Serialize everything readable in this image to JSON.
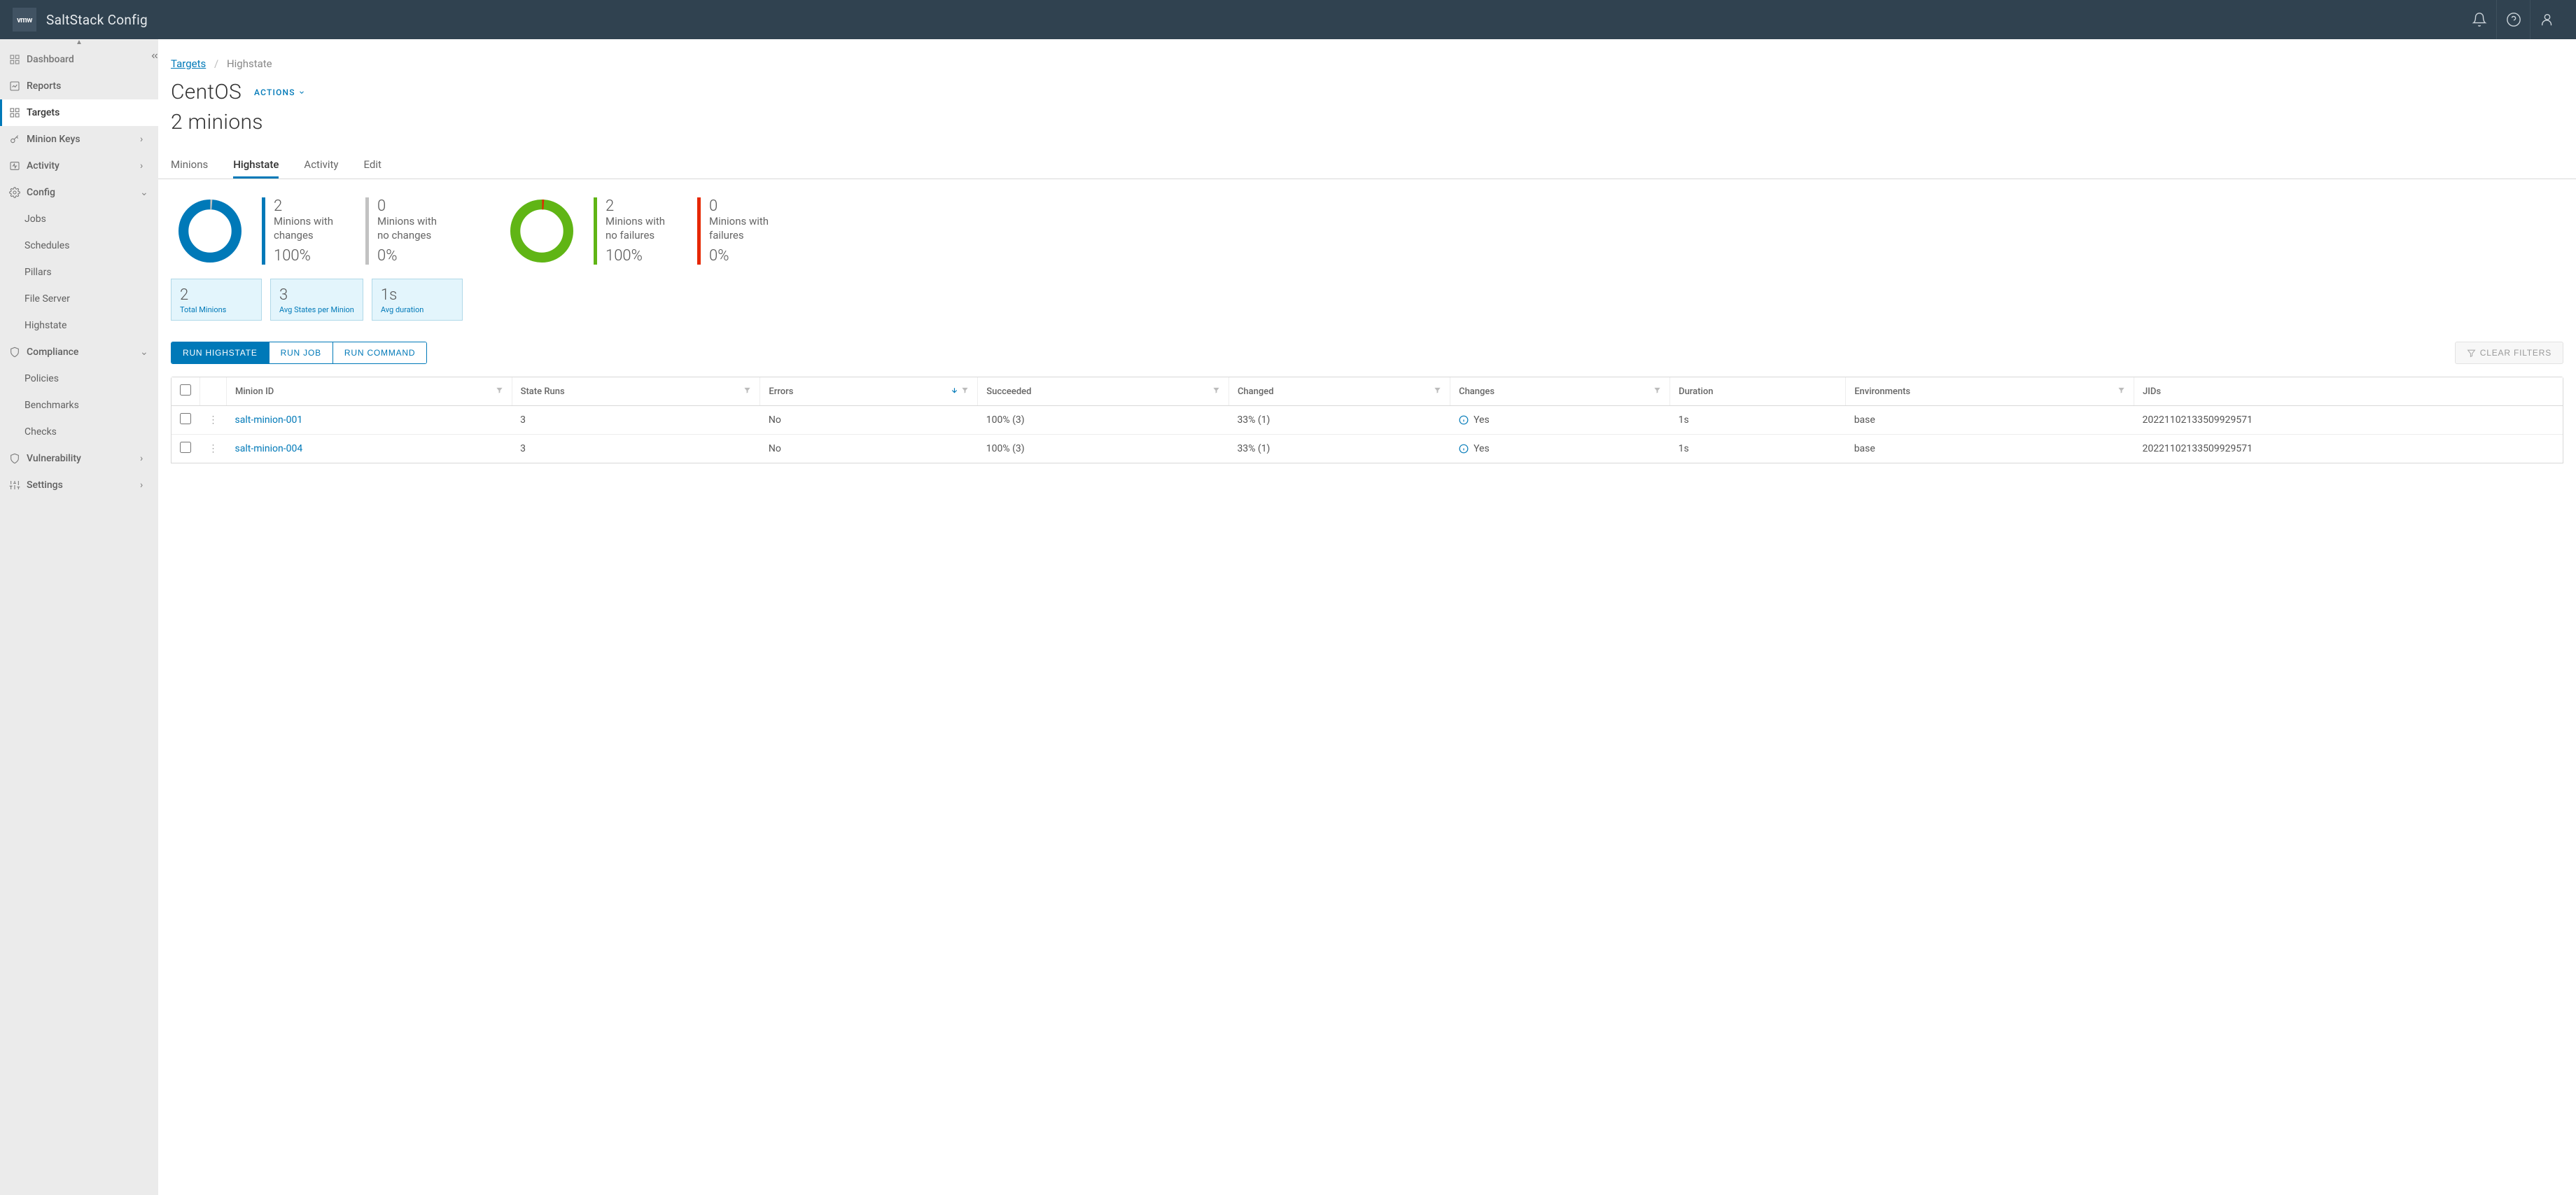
{
  "header": {
    "logo_text": "vmw",
    "product": "SaltStack Config"
  },
  "sidebar": {
    "items": [
      {
        "label": "Dashboard",
        "icon": "home"
      },
      {
        "label": "Reports",
        "icon": "chart"
      },
      {
        "label": "Targets",
        "icon": "grid",
        "active": true
      },
      {
        "label": "Minion Keys",
        "icon": "key",
        "expandable": true
      },
      {
        "label": "Activity",
        "icon": "pulse",
        "expandable": true
      },
      {
        "label": "Config",
        "icon": "gear",
        "expandable": true,
        "expanded": true,
        "children": [
          {
            "label": "Jobs"
          },
          {
            "label": "Schedules"
          },
          {
            "label": "Pillars"
          },
          {
            "label": "File Server"
          },
          {
            "label": "Highstate"
          }
        ]
      },
      {
        "label": "Compliance",
        "icon": "shield",
        "expandable": true,
        "expanded": true,
        "children": [
          {
            "label": "Policies"
          },
          {
            "label": "Benchmarks"
          },
          {
            "label": "Checks"
          }
        ]
      },
      {
        "label": "Vulnerability",
        "icon": "shield",
        "expandable": true
      },
      {
        "label": "Settings",
        "icon": "sliders",
        "expandable": true
      }
    ]
  },
  "breadcrumb": {
    "root": "Targets",
    "current": "Highstate",
    "sep": "/"
  },
  "page": {
    "title": "CentOS",
    "actions_label": "ACTIONS",
    "subtitle": "2 minions"
  },
  "tabs": [
    {
      "label": "Minions"
    },
    {
      "label": "Highstate",
      "active": true
    },
    {
      "label": "Activity"
    },
    {
      "label": "Edit"
    }
  ],
  "donut_stats": {
    "changes": [
      {
        "value": "2",
        "label1": "Minions with",
        "label2": "changes",
        "pct": "100%",
        "color": "blue"
      },
      {
        "value": "0",
        "label1": "Minions with",
        "label2": "no changes",
        "pct": "0%",
        "color": "gray"
      }
    ],
    "failures": [
      {
        "value": "2",
        "label1": "Minions with",
        "label2": "no failures",
        "pct": "100%",
        "color": "green"
      },
      {
        "value": "0",
        "label1": "Minions with",
        "label2": "failures",
        "pct": "0%",
        "color": "red"
      }
    ]
  },
  "tiles": [
    {
      "value": "2",
      "label": "Total Minions"
    },
    {
      "value": "3",
      "label": "Avg States per Minion"
    },
    {
      "value": "1s",
      "label": "Avg duration"
    }
  ],
  "buttons": {
    "run_highstate": "RUN HIGHSTATE",
    "run_job": "RUN JOB",
    "run_command": "RUN COMMAND",
    "clear_filters": "CLEAR FILTERS"
  },
  "table": {
    "columns": [
      "Minion ID",
      "State Runs",
      "Errors",
      "Succeeded",
      "Changed",
      "Changes",
      "Duration",
      "Environments",
      "JIDs"
    ],
    "rows": [
      {
        "minion_id": "salt-minion-001",
        "state_runs": "3",
        "errors": "No",
        "succeeded": "100% (3)",
        "changed": "33% (1)",
        "changes": "Yes",
        "duration": "1s",
        "environments": "base",
        "jids": "20221102133509929571"
      },
      {
        "minion_id": "salt-minion-004",
        "state_runs": "3",
        "errors": "No",
        "succeeded": "100% (3)",
        "changed": "33% (1)",
        "changes": "Yes",
        "duration": "1s",
        "environments": "base",
        "jids": "20221102133509929571"
      }
    ]
  },
  "chart_data": [
    {
      "type": "pie",
      "title": "Changes",
      "series": [
        {
          "name": "Minions with changes",
          "value": 2,
          "pct": 100
        },
        {
          "name": "Minions with no changes",
          "value": 0,
          "pct": 0
        }
      ]
    },
    {
      "type": "pie",
      "title": "Failures",
      "series": [
        {
          "name": "Minions with no failures",
          "value": 2,
          "pct": 100
        },
        {
          "name": "Minions with failures",
          "value": 0,
          "pct": 0
        }
      ]
    }
  ]
}
